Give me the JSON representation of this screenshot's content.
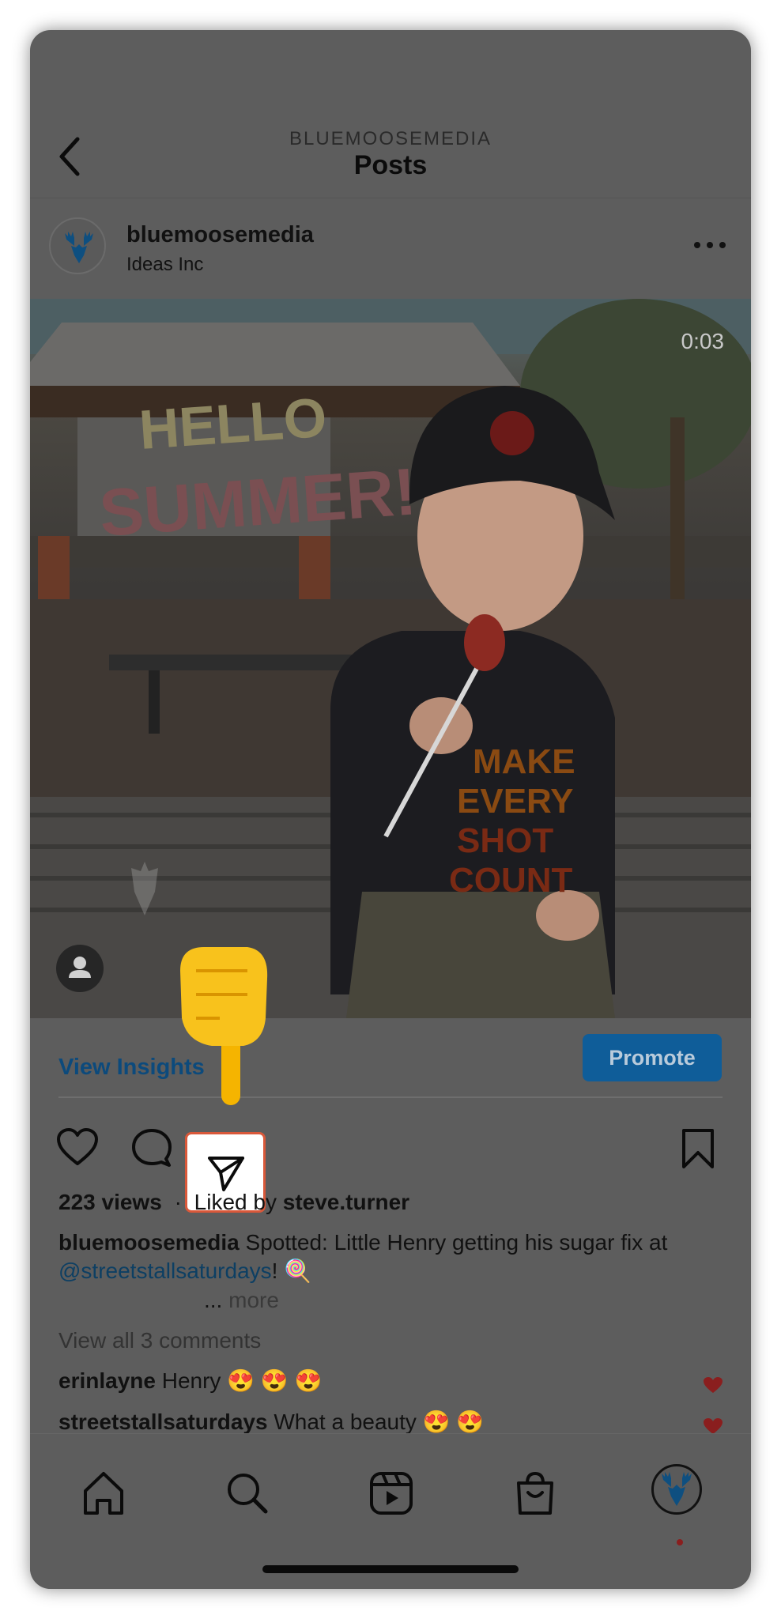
{
  "header": {
    "account": "BLUEMOOSEMEDIA",
    "title": "Posts"
  },
  "post": {
    "username": "bluemoosemedia",
    "location": "Ideas Inc",
    "timer": "0:03",
    "media_description_icon": "video-icon"
  },
  "insights": {
    "view_insights_label": "View Insights",
    "promote_label": "Promote"
  },
  "stats": {
    "views": "223 views",
    "separator": "·",
    "liked_by_prefix": "Liked by",
    "liked_by_user": "steve.turner"
  },
  "caption": {
    "username": "bluemoosemedia",
    "text_before": " Spotted: Little Henry getting his sugar fix at ",
    "mention": "@streetstallsaturdays",
    "text_after": "! 🍭",
    "ellipsis": "...",
    "more_label": "more"
  },
  "comments": {
    "view_all_label": "View all 3 comments",
    "items": [
      {
        "username": "erinlayne",
        "text": "Henry 😍 😍 😍"
      },
      {
        "username": "streetstallsaturdays",
        "text": "What a beauty 😍 😍"
      }
    ]
  },
  "icons": {
    "back": "chevron-left-icon",
    "more": "more-horizontal-icon",
    "like": "heart-icon",
    "comment": "comment-icon",
    "share": "paper-plane-icon",
    "save": "bookmark-icon",
    "pointer": "pointing-hand-emoji",
    "tabs": [
      "home-icon",
      "search-icon",
      "reels-icon",
      "shop-icon",
      "profile-avatar"
    ]
  },
  "colors": {
    "accent_blue": "#0f5d99",
    "highlight_border": "#d9583a",
    "heart_red": "#8a1e1e"
  }
}
